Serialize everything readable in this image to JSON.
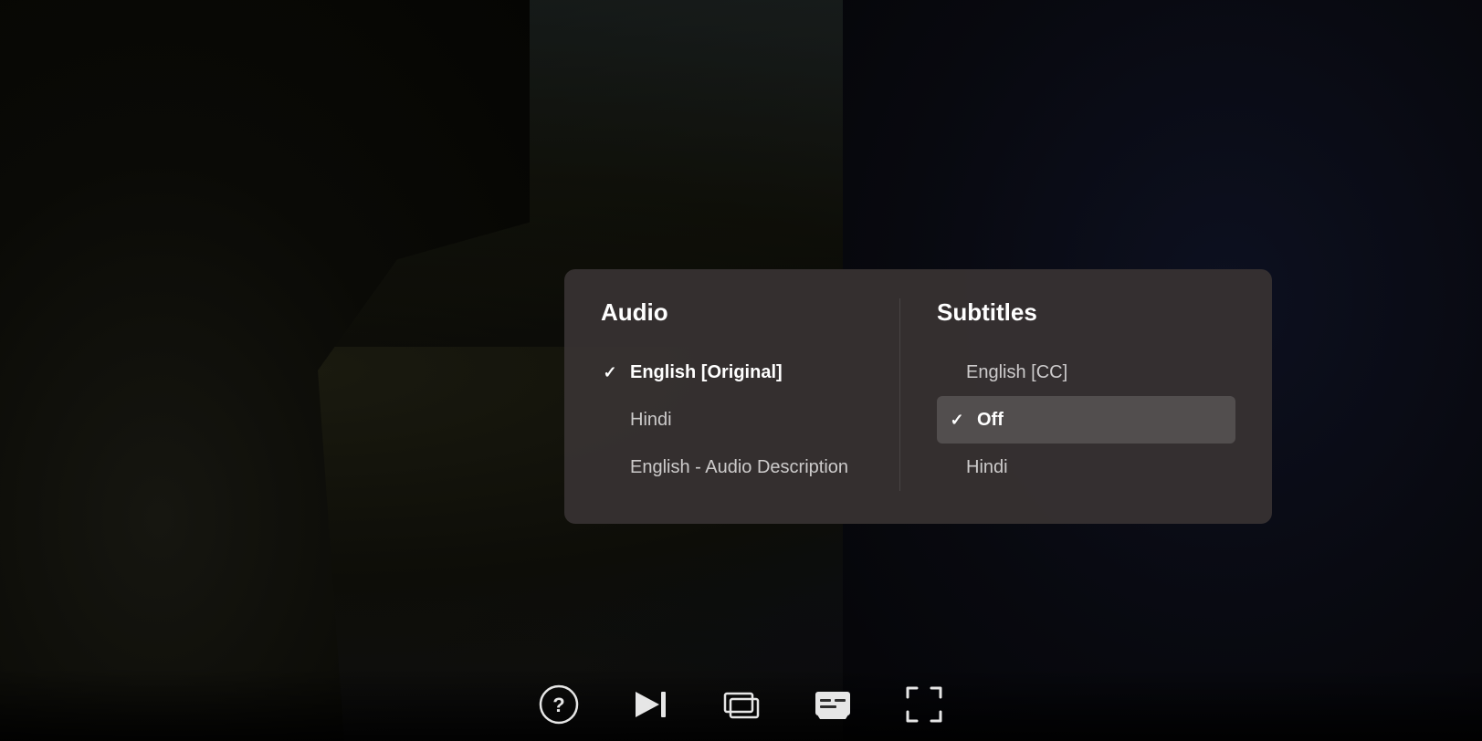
{
  "background": {
    "colors": {
      "primary": "#0a0a06",
      "secondary": "#0d1020"
    }
  },
  "modal": {
    "audio": {
      "title": "Audio",
      "items": [
        {
          "label": "English [Original]",
          "selected": true
        },
        {
          "label": "Hindi",
          "selected": false
        },
        {
          "label": "English - Audio Description",
          "selected": false
        }
      ]
    },
    "subtitles": {
      "title": "Subtitles",
      "items": [
        {
          "label": "English [CC]",
          "selected": false
        },
        {
          "label": "Off",
          "selected": true
        },
        {
          "label": "Hindi",
          "selected": false
        }
      ]
    }
  },
  "controls": {
    "help": "Help",
    "next": "Next Episode",
    "audio_subtitles": "Audio & Subtitles",
    "subtitles": "Subtitles",
    "fullscreen": "Fullscreen"
  }
}
